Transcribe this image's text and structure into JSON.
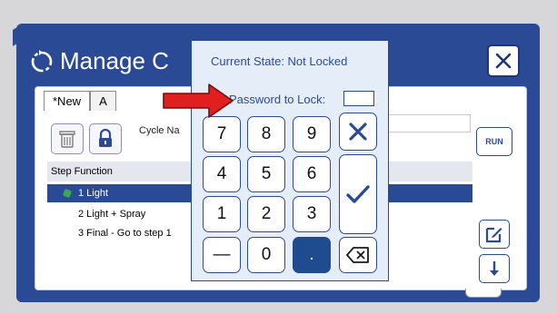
{
  "dialog": {
    "title": "Manage C",
    "close_icon": "close-x-icon",
    "title_icon": "cycle-icon"
  },
  "tabs": [
    {
      "label": "*New"
    },
    {
      "label": "A"
    }
  ],
  "toolbar": {
    "trash_icon": "trash-icon",
    "lock_icon": "lock-icon",
    "cycle_name_label": "Cycle Na",
    "run_label": "RUN"
  },
  "table": {
    "header": "Step Function",
    "rows": [
      {
        "text": "1 Light"
      },
      {
        "text": "2 Light + Spray"
      },
      {
        "text": "3 Final - Go to step 1"
      }
    ]
  },
  "side_buttons": {
    "edit_icon": "edit-icon",
    "down_icon": "arrow-down-icon"
  },
  "keypad": {
    "state": "Current State: Not Locked",
    "password_label": "Password to Lock:",
    "keys": [
      "7",
      "8",
      "9",
      "4",
      "5",
      "6",
      "1",
      "2",
      "3",
      "—",
      "0",
      "."
    ],
    "cancel_icon": "cancel-x-icon",
    "confirm_icon": "checkmark-icon",
    "backspace_icon": "backspace-icon"
  },
  "colors": {
    "brand": "#2b4a96",
    "selected_row": "#2b4a96",
    "keypad_bg": "#e5eef8",
    "arrow": "#e0201f"
  }
}
